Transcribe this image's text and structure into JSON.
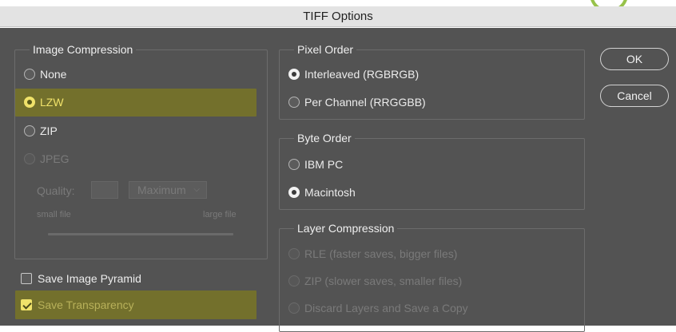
{
  "window": {
    "title": "TIFF Options"
  },
  "image_compression": {
    "legend": "Image Compression",
    "options": [
      {
        "label": "None",
        "selected": false,
        "enabled": true
      },
      {
        "label": "LZW",
        "selected": true,
        "enabled": true
      },
      {
        "label": "ZIP",
        "selected": false,
        "enabled": true
      },
      {
        "label": "JPEG",
        "selected": false,
        "enabled": false
      }
    ],
    "quality_label": "Quality:",
    "quality_value": "",
    "quality_select": "Maximum",
    "small_file_label": "small file",
    "large_file_label": "large file"
  },
  "pixel_order": {
    "legend": "Pixel Order",
    "options": [
      {
        "label": "Interleaved (RGBRGB)",
        "selected": true
      },
      {
        "label": "Per Channel (RRGGBB)",
        "selected": false
      }
    ]
  },
  "byte_order": {
    "legend": "Byte Order",
    "options": [
      {
        "label": "IBM PC",
        "selected": false
      },
      {
        "label": "Macintosh",
        "selected": true
      }
    ]
  },
  "layer_compression": {
    "legend": "Layer Compression",
    "options": [
      {
        "label": "RLE (faster saves, bigger files)",
        "enabled": false
      },
      {
        "label": "ZIP (slower saves, smaller files)",
        "enabled": false
      },
      {
        "label": "Discard Layers and Save a Copy",
        "enabled": false
      }
    ]
  },
  "checkboxes": {
    "save_pyramid": {
      "label": "Save Image Pyramid",
      "checked": false
    },
    "save_transparency": {
      "label": "Save Transparency",
      "checked": true
    }
  },
  "buttons": {
    "ok": "OK",
    "cancel": "Cancel"
  },
  "colors": {
    "dialog_bg": "#535353",
    "highlight": "#73702c",
    "accent_yellow": "#f0e26a",
    "title_bar": "#e3e3e3",
    "deco_ring": "#97c24a"
  }
}
